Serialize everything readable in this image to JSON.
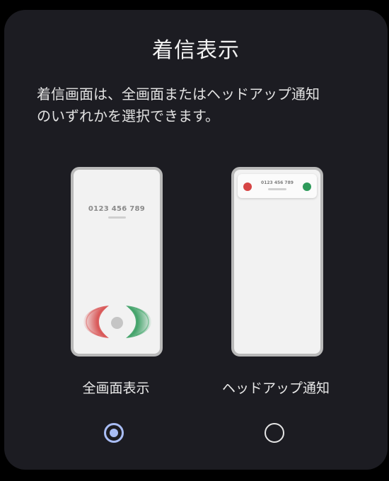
{
  "dialog": {
    "title": "着信表示",
    "description_lines": [
      "着信画面は、全画面またはヘッドアップ通知",
      "のいずれかを選択できます。"
    ]
  },
  "options": [
    {
      "id": "full_screen",
      "label": "全画面表示",
      "selected": true,
      "preview": {
        "number": "0123 456 789",
        "decline_color": "#d64545",
        "accept_color": "#2e9a5a"
      }
    },
    {
      "id": "heads_up",
      "label": "ヘッドアップ通知",
      "selected": false,
      "preview": {
        "number": "0123 456 789",
        "decline_color": "#d64545",
        "accept_color": "#2e9a5a"
      }
    }
  ],
  "colors": {
    "background": "#1c1c22",
    "radio_selected": "#a9bdf5",
    "radio_unselected": "#e5e5e5"
  }
}
